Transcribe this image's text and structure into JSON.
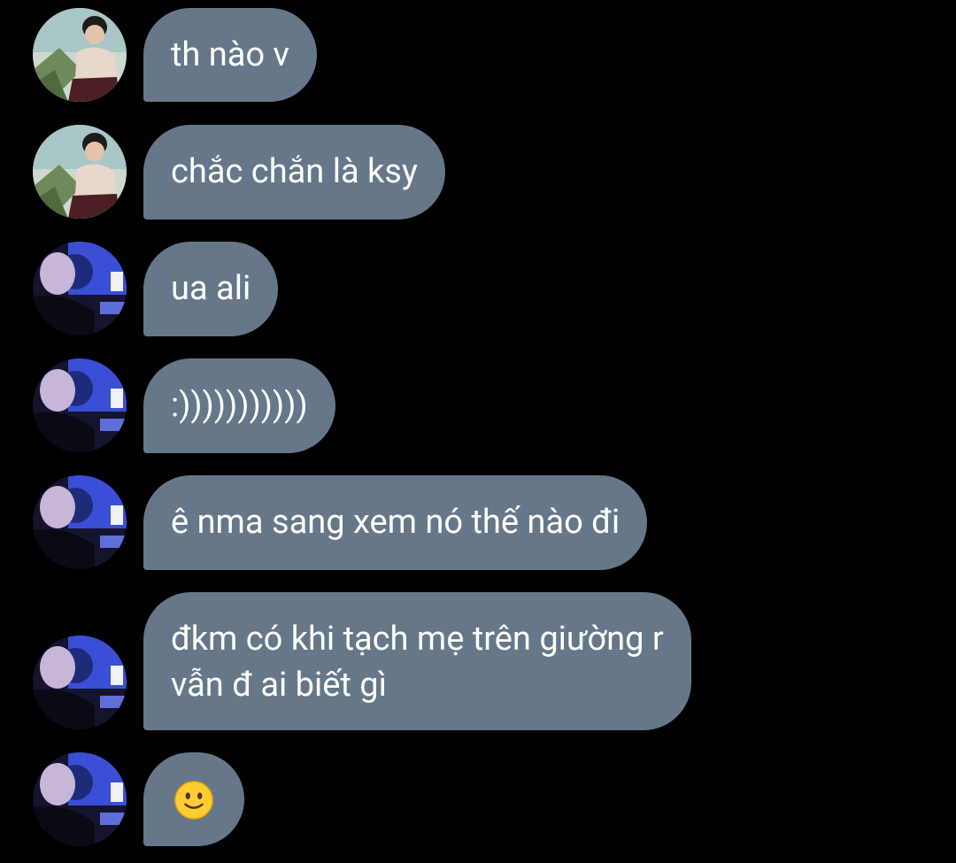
{
  "messages": [
    {
      "sender": "user-a",
      "text": "th nào v"
    },
    {
      "sender": "user-a",
      "text": "chắc chắn là ksy"
    },
    {
      "sender": "user-b",
      "text": "ua ali"
    },
    {
      "sender": "user-b",
      "text": ":)))))))))))"
    },
    {
      "sender": "user-b",
      "text": "ê nma sang xem nó thế nào đi"
    },
    {
      "sender": "user-b",
      "lines": [
        "đkm có khi tạch mẹ trên giường r",
        "vẫn đ ai biết gì"
      ]
    },
    {
      "sender": "user-b",
      "emoji": "slightly-smiling-face"
    }
  ],
  "colors": {
    "background": "#000000",
    "bubble": "#66778a",
    "text": "#ffffff"
  }
}
